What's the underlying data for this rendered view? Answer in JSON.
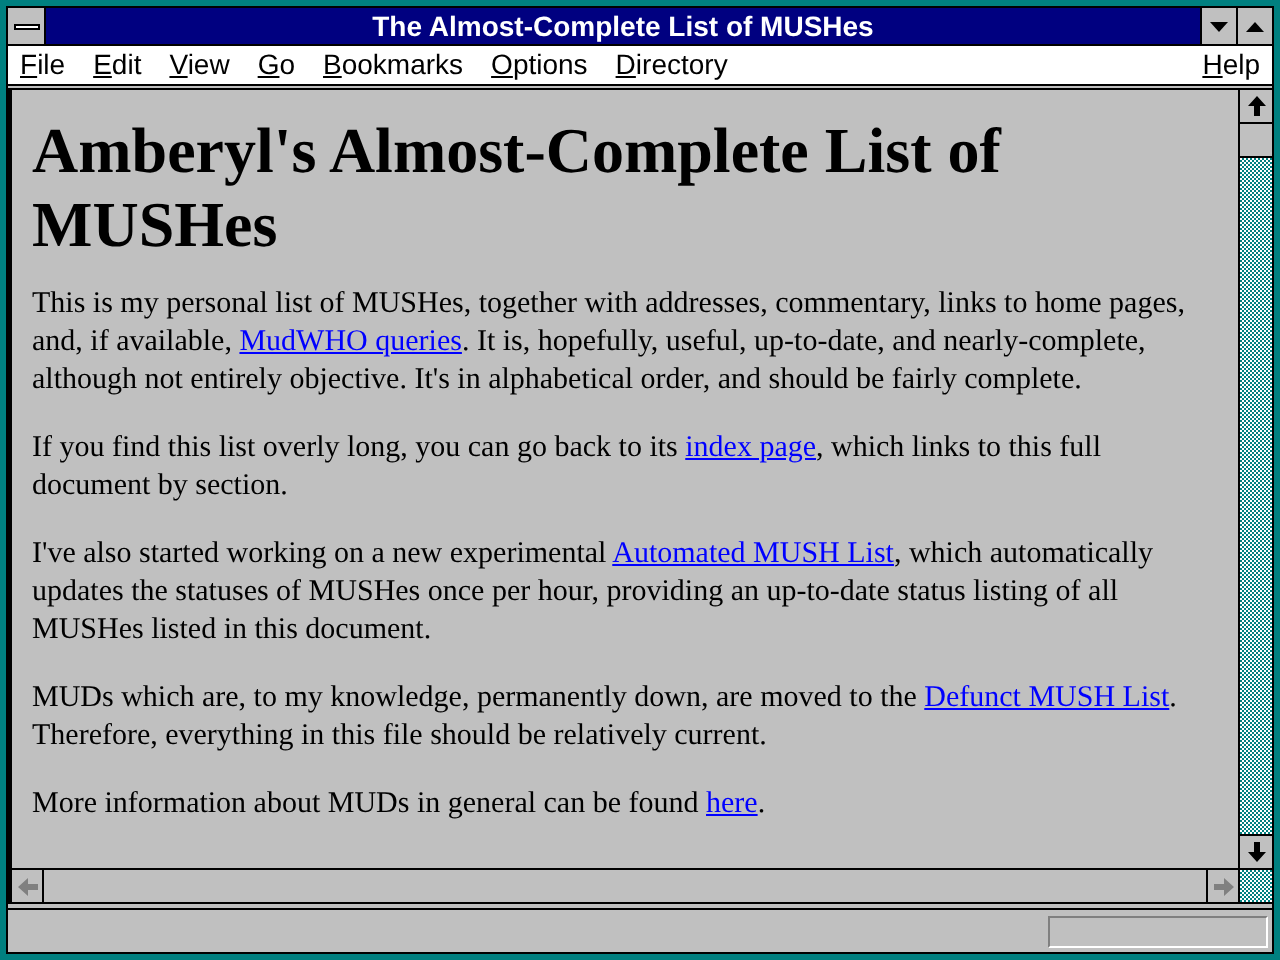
{
  "window": {
    "title": "The Almost-Complete List of MUSHes"
  },
  "menu": [
    {
      "label": "File"
    },
    {
      "label": "Edit"
    },
    {
      "label": "View"
    },
    {
      "label": "Go"
    },
    {
      "label": "Bookmarks"
    },
    {
      "label": "Options"
    },
    {
      "label": "Directory"
    },
    {
      "label": "Help",
      "kind": "right"
    }
  ],
  "heading": "Amberyl's Almost-Complete List of MUSHes",
  "paragraphs": [
    {
      "segments": [
        {
          "kind": "text",
          "text": "This is my personal list of MUSHes, together with addresses, commentary, links to home pages, and, if available, "
        },
        {
          "kind": "link",
          "text": "MudWHO queries"
        },
        {
          "kind": "text",
          "text": ". It is, hopefully, useful, up-to-date, and nearly-complete, although not entirely objective. It's in alphabetical order, and should be fairly complete."
        }
      ]
    },
    {
      "segments": [
        {
          "kind": "text",
          "text": "If you find this list overly long, you can go back to its "
        },
        {
          "kind": "link",
          "text": "index page"
        },
        {
          "kind": "text",
          "text": ", which links to this full document by section."
        }
      ]
    },
    {
      "segments": [
        {
          "kind": "text",
          "text": "I've also started working on a new experimental "
        },
        {
          "kind": "link",
          "text": "Automated MUSH List"
        },
        {
          "kind": "text",
          "text": ", which automatically updates the statuses of MUSHes once per hour, providing an up-to-date status listing of all MUSHes listed in this document."
        }
      ]
    },
    {
      "segments": [
        {
          "kind": "text",
          "text": "MUDs which are, to my knowledge, permanently down, are moved to the "
        },
        {
          "kind": "link",
          "text": "Defunct MUSH List"
        },
        {
          "kind": "text",
          "text": ". Therefore, everything in this file should be relatively current."
        }
      ]
    },
    {
      "segments": [
        {
          "kind": "text",
          "text": "More information about MUDs in general can be found "
        },
        {
          "kind": "link",
          "text": "here"
        },
        {
          "kind": "text",
          "text": "."
        }
      ]
    }
  ]
}
